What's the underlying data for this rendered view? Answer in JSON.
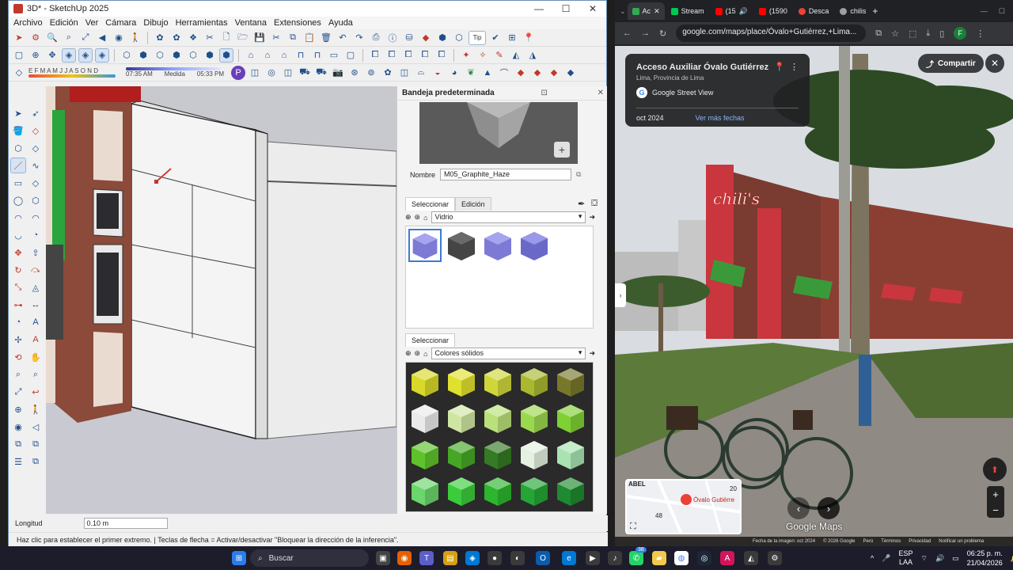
{
  "sketchup": {
    "title": "3D* - SketchUp 2025",
    "menu": [
      "Archivo",
      "Edición",
      "Ver",
      "Cámara",
      "Dibujo",
      "Herramientas",
      "Ventana",
      "Extensiones",
      "Ayuda"
    ],
    "tags_field": "Tip",
    "months": "E F M A M J J A S O N D",
    "time_start": "07:35 AM",
    "time_mid": "Medida",
    "time_end": "05:33 PM",
    "tray": {
      "title": "Bandeja predeterminada",
      "name_label": "Nombre",
      "name_value": "M05_Graphite_Haze",
      "tab_select": "Seleccionar",
      "tab_edit": "Edición",
      "library_1": "Vidrio",
      "tab_select_2": "Seleccionar",
      "library_2": "Colores sólidos"
    },
    "length_label": "Longitud",
    "length_value": "0.10 m",
    "status_text": "Haz clic para establecer el primer extremo. | Teclas de flecha = Activar/desactivar \"Bloquear la dirección de la inferencia\"."
  },
  "chrome": {
    "tabs": [
      {
        "label": "Ac",
        "color": "#34a853"
      },
      {
        "label": "Stream",
        "color": "#00c853"
      },
      {
        "label": "(15",
        "color": "#ff0000"
      },
      {
        "label": "(1590",
        "color": "#ff0000"
      },
      {
        "label": "Desca",
        "color": "#ea4335"
      },
      {
        "label": "chilis",
        "color": "#9aa0a6"
      }
    ],
    "url": "google.com/maps/place/Óvalo+Gutiérrez,+Lima...",
    "profile_initial": "F",
    "card": {
      "place": "Acceso Auxiliar Óvalo Gutiérrez",
      "city": "Lima, Provincia de Lima",
      "source": "Google Street View",
      "date": "oct 2024",
      "more_dates": "Ver más fechas"
    },
    "share_label": "Compartir",
    "sign_text": "chili's",
    "minimap": {
      "place": "Óvalo Gutiérre",
      "label_top": "ABEL",
      "number_a": "20",
      "number_b": "48"
    },
    "logo": "Google Maps",
    "footer": [
      "Fecha de la imagen: oct 2024",
      "© 2026 Google",
      "Perú",
      "Términos",
      "Privacidad",
      "Notificar un problema"
    ]
  },
  "taskbar": {
    "search": "Buscar",
    "badge": "38",
    "lang_top": "ESP",
    "lang_bottom": "LAA",
    "time": "06:25 p. m.",
    "date": "21/04/2026"
  }
}
